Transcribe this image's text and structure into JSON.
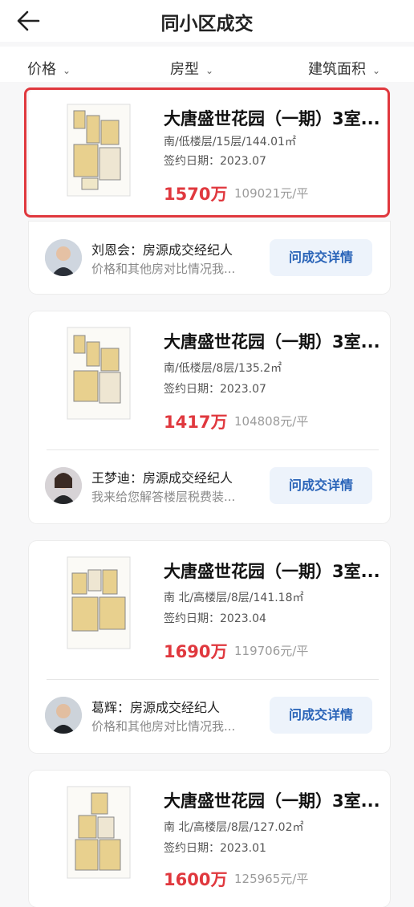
{
  "header": {
    "title": "同小区成交"
  },
  "filters": [
    {
      "label": "价格"
    },
    {
      "label": "房型"
    },
    {
      "label": "建筑面积"
    }
  ],
  "listings": [
    {
      "name": "大唐盛世花园（一期）3室...",
      "info": "南/低楼层/15层/144.01㎡",
      "date": "签约日期：2023.07",
      "price": "1570万",
      "unit_price": "109021元/平",
      "agent": {
        "name": "刘恩会：房源成交经纪人",
        "message": "价格和其他房对比情况我...",
        "button": "问成交详情"
      }
    },
    {
      "name": "大唐盛世花园（一期）3室...",
      "info": "南/低楼层/8层/135.2㎡",
      "date": "签约日期：2023.07",
      "price": "1417万",
      "unit_price": "104808元/平",
      "agent": {
        "name": "王梦迪：房源成交经纪人",
        "message": "我来给您解答楼层税费装...",
        "button": "问成交详情"
      }
    },
    {
      "name": "大唐盛世花园（一期）3室...",
      "info": "南 北/高楼层/8层/141.18㎡",
      "date": "签约日期：2023.04",
      "price": "1690万",
      "unit_price": "119706元/平",
      "agent": {
        "name": "葛辉：房源成交经纪人",
        "message": "价格和其他房对比情况我...",
        "button": "问成交详情"
      }
    },
    {
      "name": "大唐盛世花园（一期）3室...",
      "info": "南 北/高楼层/8层/127.02㎡",
      "date": "签约日期：2023.01",
      "price": "1600万",
      "unit_price": "125965元/平"
    }
  ],
  "colors": {
    "price": "#e0383e",
    "highlight_border": "#e0383e",
    "button_text": "#2a64b8",
    "button_bg": "#edf3fb"
  }
}
